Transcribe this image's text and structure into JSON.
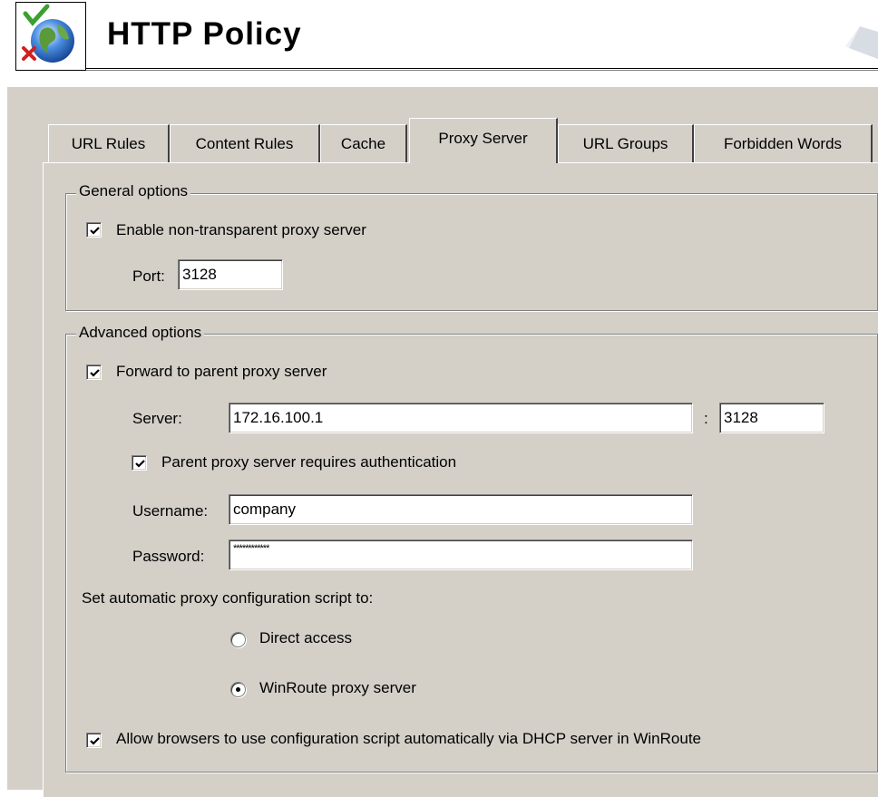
{
  "header": {
    "title": "HTTP Policy",
    "icon": "globe-check-icon"
  },
  "tabs": [
    {
      "label": "URL Rules",
      "active": false
    },
    {
      "label": "Content Rules",
      "active": false
    },
    {
      "label": "Cache",
      "active": false
    },
    {
      "label": "Proxy Server",
      "active": true
    },
    {
      "label": "URL Groups",
      "active": false
    },
    {
      "label": "Forbidden Words",
      "active": false
    }
  ],
  "general": {
    "legend": "General options",
    "enable_proxy": {
      "label": "Enable non-transparent proxy server",
      "checked": true
    },
    "port_label": "Port:",
    "port_value": "3128"
  },
  "advanced": {
    "legend": "Advanced options",
    "forward_parent": {
      "label": "Forward to parent proxy server",
      "checked": true
    },
    "server_label": "Server:",
    "server_value": "172.16.100.1",
    "server_sep": ":",
    "server_port_value": "3128",
    "auth_required": {
      "label": "Parent proxy server requires authentication",
      "checked": true
    },
    "username_label": "Username:",
    "username_value": "company",
    "password_label": "Password:",
    "password_value": "************",
    "script_label": "Set automatic proxy configuration script to:",
    "radio_direct": {
      "label": "Direct access",
      "selected": false
    },
    "radio_winroute": {
      "label": "WinRoute proxy server",
      "selected": true
    },
    "allow_dhcp": {
      "label": "Allow browsers to use configuration script automatically via DHCP server in WinRoute",
      "checked": true
    }
  },
  "colors": {
    "dialog_bg": "#d4d0c8",
    "shadow": "#808080",
    "highlight": "#ffffff"
  }
}
